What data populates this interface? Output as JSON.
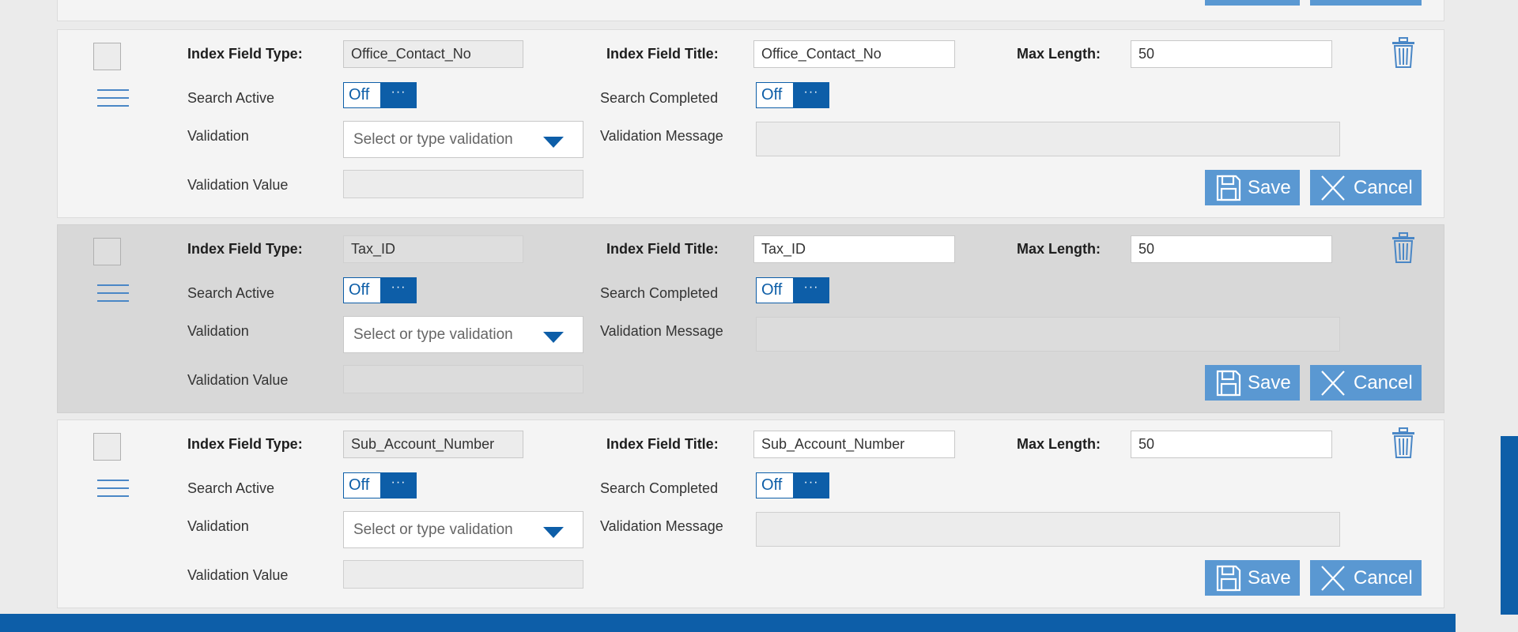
{
  "labels": {
    "index_field_type": "Index Field Type:",
    "index_field_title": "Index Field Title:",
    "max_length": "Max Length:",
    "search_active": "Search Active",
    "search_completed": "Search Completed",
    "validation": "Validation",
    "validation_message": "Validation Message",
    "validation_value": "Validation Value",
    "toggle_off": "Off",
    "toggle_dots": "···",
    "validation_placeholder": "Select or type validation",
    "save": "Save",
    "cancel": "Cancel"
  },
  "fields": [
    {
      "index_field_type": "Office_Contact_No",
      "index_field_title": "Office_Contact_No",
      "max_length": "50",
      "search_active": "Off",
      "search_completed": "Off",
      "highlighted": false
    },
    {
      "index_field_type": "Tax_ID",
      "index_field_title": "Tax_ID",
      "max_length": "50",
      "search_active": "Off",
      "search_completed": "Off",
      "highlighted": true
    },
    {
      "index_field_type": "Sub_Account_Number",
      "index_field_title": "Sub_Account_Number",
      "max_length": "50",
      "search_active": "Off",
      "search_completed": "Off",
      "highlighted": false
    }
  ],
  "colors": {
    "accent": "#0d5ea8",
    "button": "#5a98d2",
    "card_bg": "#f4f4f4",
    "card_highlight_bg": "#d8d8d8"
  },
  "icons": [
    "checkbox",
    "drag-handle-icon",
    "trash-icon",
    "save-icon",
    "close-icon",
    "caret-down-icon"
  ]
}
